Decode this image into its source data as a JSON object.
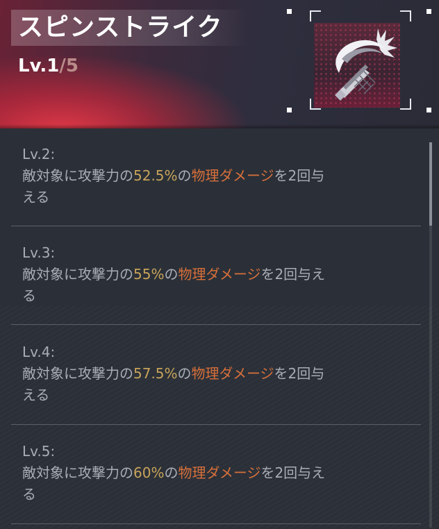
{
  "skill": {
    "name": "スピンストライク",
    "level_current": "Lv.1",
    "level_sep": "/",
    "level_max": "5",
    "icon": "spin-slash-icon"
  },
  "colors": {
    "percent": "#c8a45a",
    "damage_type": "#d8703a",
    "text": "#a9adb6"
  },
  "levels": [
    {
      "label": "Lv.2:",
      "prefix": "敵対象に攻撃力の",
      "percent": "52.5%",
      "mid": "の",
      "damage": "物理ダメージ",
      "suffix_line1": "を2回与",
      "suffix_line2": "える"
    },
    {
      "label": "Lv.3:",
      "prefix": "敵対象に攻撃力の",
      "percent": "55%",
      "mid": "の",
      "damage": "物理ダメージ",
      "suffix_line1": "を2回与え",
      "suffix_line2": "る"
    },
    {
      "label": "Lv.4:",
      "prefix": "敵対象に攻撃力の",
      "percent": "57.5%",
      "mid": "の",
      "damage": "物理ダメージ",
      "suffix_line1": "を2回与",
      "suffix_line2": "える"
    },
    {
      "label": "Lv.5:",
      "prefix": "敵対象に攻撃力の",
      "percent": "60%",
      "mid": "の",
      "damage": "物理ダメージ",
      "suffix_line1": "を2回与え",
      "suffix_line2": "る"
    }
  ]
}
